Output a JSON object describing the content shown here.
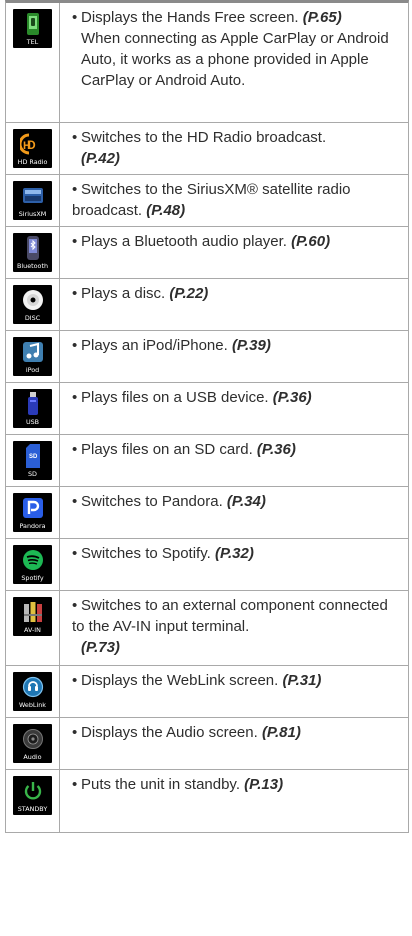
{
  "rows": [
    {
      "label": "TEL",
      "icon": "phone-icon",
      "text": "Displays the Hands Free screen.",
      "ref": "(P.65)",
      "extra": "When connecting as Apple CarPlay or Android Auto, it works as a phone provided in Apple CarPlay or Android Auto."
    },
    {
      "label": "HD Radio",
      "icon": "hd-radio-icon",
      "text": "Switches to the HD Radio broadcast.",
      "ref": "(P.42)"
    },
    {
      "label": "SiriusXM",
      "icon": "siriusxm-icon",
      "text": "Switches to the SiriusXM® satellite radio broadcast.",
      "ref": "(P.48)"
    },
    {
      "label": "Bluetooth",
      "icon": "bluetooth-player-icon",
      "text": "Plays a Bluetooth audio player.",
      "ref": "(P.60)"
    },
    {
      "label": "DISC",
      "icon": "disc-icon",
      "text": "Plays a disc.",
      "ref": "(P.22)"
    },
    {
      "label": "iPod",
      "icon": "ipod-icon",
      "text": "Plays an iPod/iPhone.",
      "ref": "(P.39)"
    },
    {
      "label": "USB",
      "icon": "usb-icon",
      "text": "Plays files on a USB device.",
      "ref": "(P.36)"
    },
    {
      "label": "SD",
      "icon": "sd-card-icon",
      "text": "Plays files on an SD card.",
      "ref": "(P.36)"
    },
    {
      "label": "Pandora",
      "icon": "pandora-icon",
      "text": "Switches to Pandora.",
      "ref": "(P.34)"
    },
    {
      "label": "Spotify",
      "icon": "spotify-icon",
      "text": "Switches to Spotify.",
      "ref": "(P.32)"
    },
    {
      "label": "AV-IN",
      "icon": "av-in-icon",
      "text": "Switches to an external component connected to the AV-IN input terminal.",
      "ref": "(P.73)"
    },
    {
      "label": "WebLink",
      "icon": "weblink-icon",
      "text": "Displays the WebLink screen.",
      "ref": "(P.31)"
    },
    {
      "label": "Audio",
      "icon": "audio-icon",
      "text": "Displays the Audio screen.",
      "ref": "(P.81)"
    },
    {
      "label": "STANDBY",
      "icon": "standby-icon",
      "text": "Puts the unit in standby.",
      "ref": "(P.13)"
    }
  ],
  "colors": {
    "border": "#a9a9a9",
    "tile": "#000000",
    "hd_orange": "#f29a1a",
    "spotify_green": "#1db954",
    "pandora_blue": "#2a5ee8",
    "standby_green": "#39b54a"
  }
}
